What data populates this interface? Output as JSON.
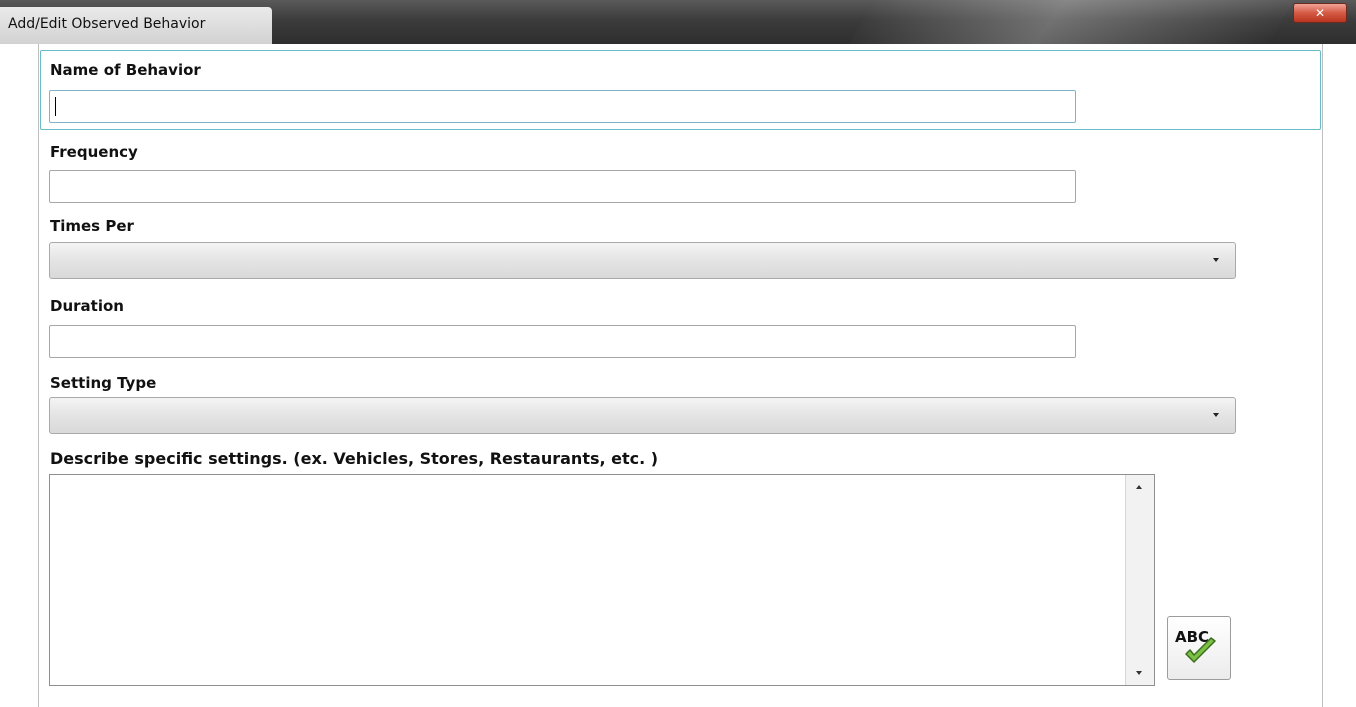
{
  "window": {
    "title": "Add/Edit Observed Behavior",
    "close_glyph": "✕"
  },
  "form": {
    "name_of_behavior": {
      "label": "Name of Behavior",
      "value": ""
    },
    "frequency": {
      "label": "Frequency",
      "value": ""
    },
    "times_per": {
      "label": "Times Per",
      "selected": ""
    },
    "duration": {
      "label": "Duration",
      "value": ""
    },
    "setting_type": {
      "label": "Setting Type",
      "selected": ""
    },
    "specific_settings": {
      "label": "Describe specific settings. (ex. Vehicles, Stores, Restaurants, etc. )",
      "value": ""
    },
    "spellcheck": {
      "label": "ABC",
      "icon": "checkmark-icon",
      "accent": "#7cc043"
    }
  }
}
